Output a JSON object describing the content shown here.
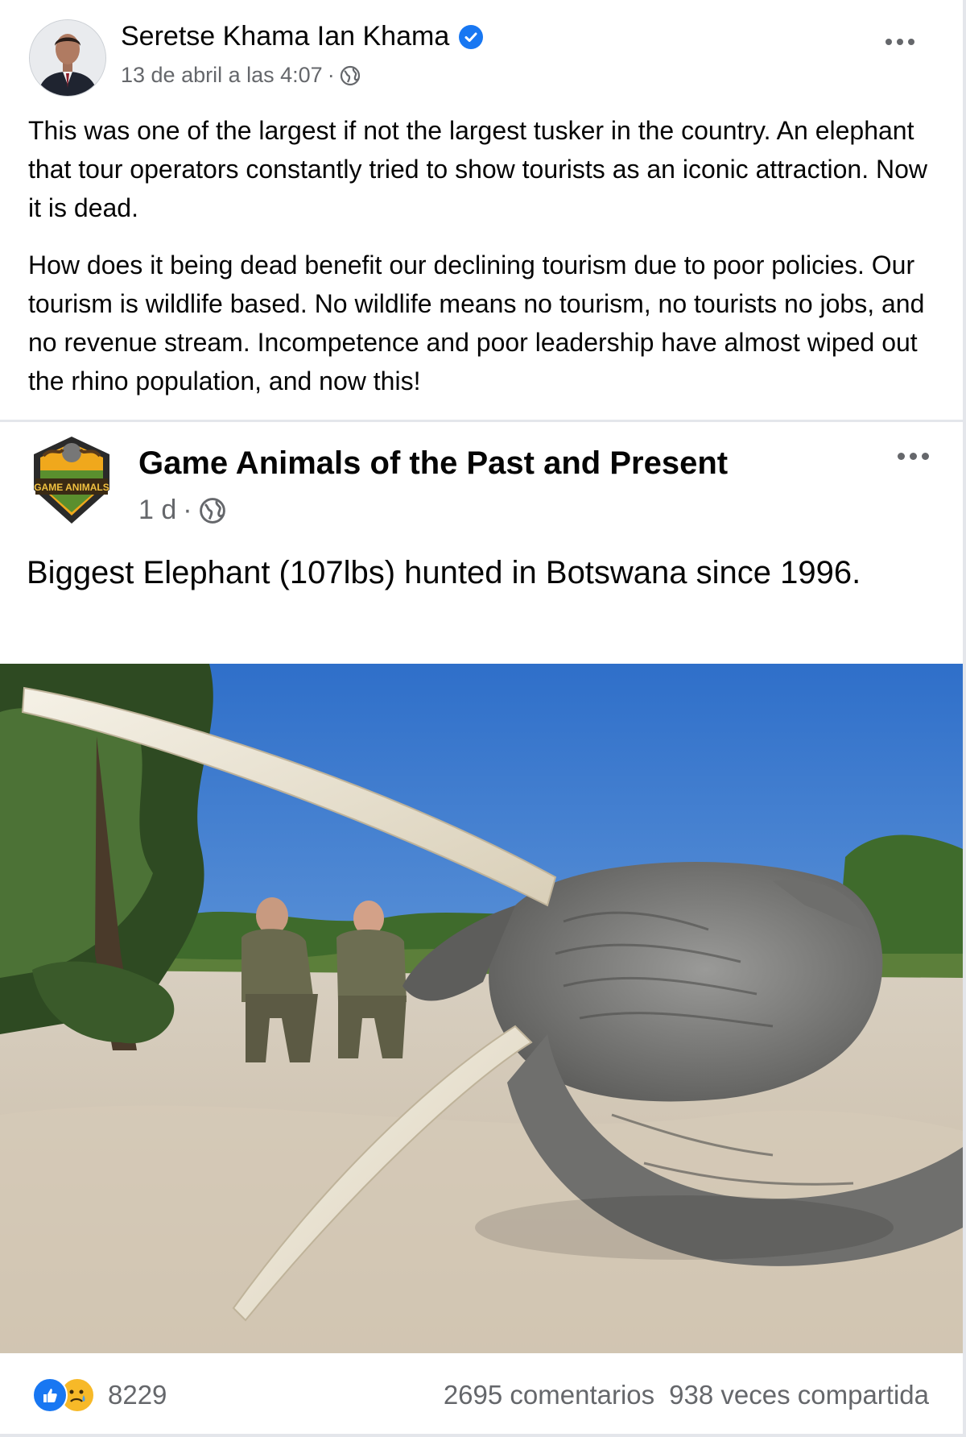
{
  "post": {
    "author": "Seretse Khama Ian Khama",
    "timestamp": "13 de abril a las 4:07",
    "separator": "·",
    "paragraphs": [
      "This was one of the largest if not the largest tusker in the country. An elephant that tour operators constantly tried to show tourists as an iconic attraction. Now it is dead.",
      "How does it being dead benefit our declining tourism due to poor policies. Our tourism is wildlife based. No wildlife means no tourism, no tourists no jobs, and no revenue stream. Incompetence and poor leadership have almost wiped out the rhino population, and now this!"
    ]
  },
  "shared": {
    "page_name": "Game Animals of the Past and Present",
    "logo_text": "GAME ANIMALS",
    "timestamp": "1 d",
    "separator": "·",
    "text": "Biggest Elephant (107lbs) hunted in Botswana since 1996."
  },
  "footer": {
    "reaction_count": "8229",
    "comments": "2695 comentarios",
    "shares": "938 veces compartida"
  },
  "colors": {
    "facebook_blue": "#1877f2",
    "secondary_text": "#65676b"
  }
}
